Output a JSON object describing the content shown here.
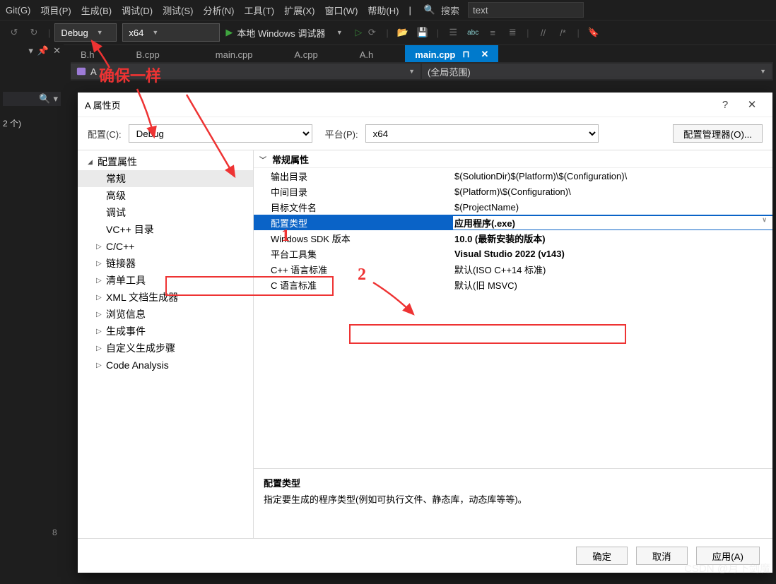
{
  "menubar": {
    "items": [
      "Git(G)",
      "项目(P)",
      "生成(B)",
      "调试(D)",
      "测试(S)",
      "分析(N)",
      "工具(T)",
      "扩展(X)",
      "窗口(W)",
      "帮助(H)"
    ],
    "search_label": "搜索",
    "search_value": "text"
  },
  "toolbar": {
    "config_value": "Debug",
    "platform_value": "x64",
    "debugger_label": "本地 Windows 调试器"
  },
  "tabs": [
    {
      "label": "B.h",
      "active": false
    },
    {
      "label": "B.cpp",
      "active": false
    },
    {
      "label": "main.cpp",
      "active": false
    },
    {
      "label": "A.cpp",
      "active": false
    },
    {
      "label": "A.h",
      "active": false
    },
    {
      "label": "main.cpp",
      "active": true
    }
  ],
  "dropdown_bar": {
    "combo1": "A",
    "combo2": "(全局范围)"
  },
  "left_panel": {
    "note": "2 个)"
  },
  "dialog": {
    "title": "A 属性页",
    "config_label": "配置(C):",
    "config_value": "Debug",
    "platform_label": "平台(P):",
    "platform_value": "x64",
    "mgr_btn": "配置管理器(O)...",
    "tree": {
      "root": "配置属性",
      "items": [
        "常规",
        "高级",
        "调试",
        "VC++ 目录",
        "C/C++",
        "链接器",
        "清单工具",
        "XML 文档生成器",
        "浏览信息",
        "生成事件",
        "自定义生成步骤",
        "Code Analysis"
      ]
    },
    "props": {
      "header": "常规属性",
      "rows": [
        {
          "k": "输出目录",
          "v": "$(SolutionDir)$(Platform)\\$(Configuration)\\"
        },
        {
          "k": "中间目录",
          "v": "$(Platform)\\$(Configuration)\\"
        },
        {
          "k": "目标文件名",
          "v": "$(ProjectName)"
        },
        {
          "k": "配置类型",
          "v": "应用程序(.exe)",
          "sel": true,
          "bold": true
        },
        {
          "k": "Windows SDK 版本",
          "v": "10.0 (最新安装的版本)",
          "bold": true
        },
        {
          "k": "平台工具集",
          "v": "Visual Studio 2022 (v143)",
          "bold": true
        },
        {
          "k": "C++ 语言标准",
          "v": "默认(ISO C++14 标准)"
        },
        {
          "k": "C 语言标准",
          "v": "默认(旧 MSVC)"
        }
      ]
    },
    "desc": {
      "title": "配置类型",
      "text": "指定要生成的程序类型(例如可执行文件、静态库，动态库等等)。"
    },
    "footer": {
      "ok": "确定",
      "cancel": "取消",
      "apply": "应用(A)"
    }
  },
  "annotations": {
    "same_label": "确保一样",
    "one": "1",
    "two": "2"
  },
  "status": {
    "num": "8"
  },
  "watermark": "CSDN @月下剑魔"
}
